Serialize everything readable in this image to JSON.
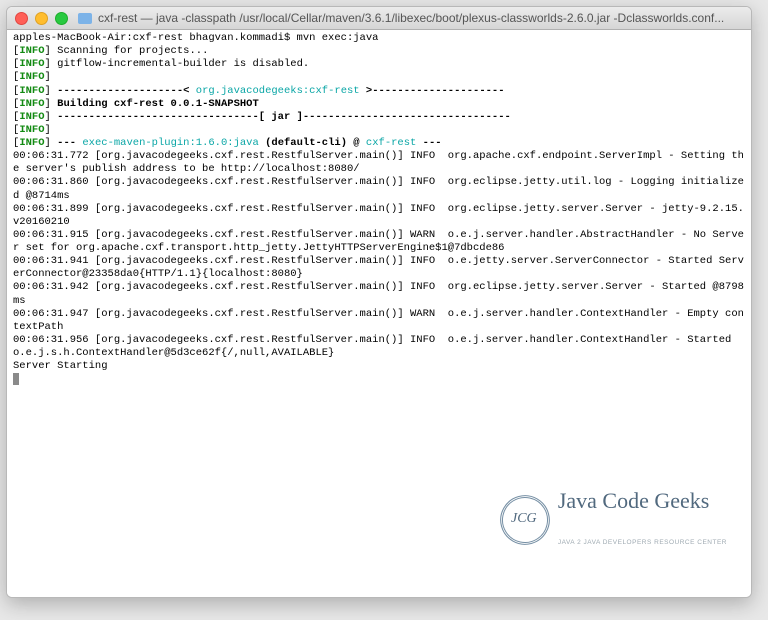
{
  "window": {
    "title": "cxf-rest — java -classpath /usr/local/Cellar/maven/3.6.1/libexec/boot/plexus-classworlds-2.6.0.jar -Dclassworlds.conf..."
  },
  "prompt": "apples-MacBook-Air:cxf-rest bhagvan.kommadi$ ",
  "command": "mvn exec:java",
  "info_label": "INFO",
  "lines": {
    "scanning": "Scanning for projects...",
    "gitflow": "gitflow-incremental-builder is disabled.",
    "divider_pre": "--------------------< ",
    "project_ga": "org.javacodegeeks:cxf-rest",
    "divider_post": " >---------------------",
    "building": "Building cxf-rest 0.0.1-SNAPSHOT",
    "jar_divider": "--------------------------------[ jar ]---------------------------------",
    "exec_pre": "--- ",
    "exec_plugin": "exec-maven-plugin:1.6.0:java",
    "exec_mid": " (default-cli) @ ",
    "exec_proj": "cxf-rest",
    "exec_post": " ---"
  },
  "logs": [
    "00:06:31.772 [org.javacodegeeks.cxf.rest.RestfulServer.main()] INFO  org.apache.cxf.endpoint.ServerImpl - Setting the server's publish address to be http://localhost:8080/",
    "00:06:31.860 [org.javacodegeeks.cxf.rest.RestfulServer.main()] INFO  org.eclipse.jetty.util.log - Logging initialized @8714ms",
    "00:06:31.899 [org.javacodegeeks.cxf.rest.RestfulServer.main()] INFO  org.eclipse.jetty.server.Server - jetty-9.2.15.v20160210",
    "00:06:31.915 [org.javacodegeeks.cxf.rest.RestfulServer.main()] WARN  o.e.j.server.handler.AbstractHandler - No Server set for org.apache.cxf.transport.http_jetty.JettyHTTPServerEngine$1@7dbcde86",
    "00:06:31.941 [org.javacodegeeks.cxf.rest.RestfulServer.main()] INFO  o.e.jetty.server.ServerConnector - Started ServerConnector@23358da0{HTTP/1.1}{localhost:8080}",
    "00:06:31.942 [org.javacodegeeks.cxf.rest.RestfulServer.main()] INFO  org.eclipse.jetty.server.Server - Started @8798ms",
    "00:06:31.947 [org.javacodegeeks.cxf.rest.RestfulServer.main()] WARN  o.e.j.server.handler.ContextHandler - Empty contextPath",
    "00:06:31.956 [org.javacodegeeks.cxf.rest.RestfulServer.main()] INFO  o.e.j.server.handler.ContextHandler - Started o.e.j.s.h.ContextHandler@5d3ce62f{/,null,AVAILABLE}",
    "Server Starting"
  ],
  "watermark": {
    "badge": "JCG",
    "title": "Java Code Geeks",
    "subtitle": "JAVA 2 JAVA DEVELOPERS RESOURCE CENTER"
  }
}
